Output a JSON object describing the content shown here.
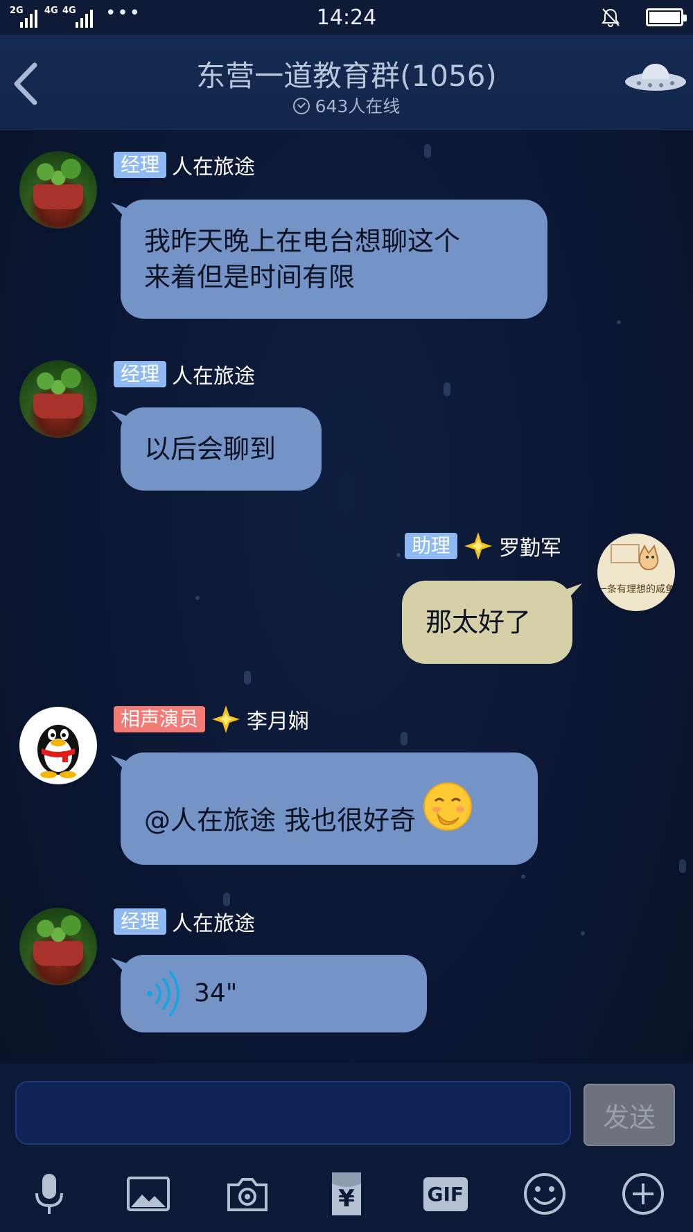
{
  "status_bar": {
    "net1_label": "2G",
    "net2_label": "4G",
    "net3_label": "4G",
    "more": "•••",
    "time": "14:24"
  },
  "header": {
    "title": "东营一道教育群(1056)",
    "online": "643人在线"
  },
  "messages": [
    {
      "badge": "经理",
      "name": "人在旅途",
      "text_line1": "我昨天晚上在电台想聊这个",
      "text_line2": "来着但是时间有限"
    },
    {
      "badge": "经理",
      "name": "人在旅途",
      "text": "以后会聊到"
    },
    {
      "badge": "助理",
      "name": "罗勤军",
      "text": "那太好了",
      "avatar_caption": "一条有理想的咸鱼"
    },
    {
      "badge": "相声演员",
      "name": "李月娴",
      "text": "@人在旅途 我也很好奇"
    },
    {
      "badge": "经理",
      "name": "人在旅途",
      "voice_duration": "34\""
    }
  ],
  "input": {
    "placeholder": "",
    "send_label": "发送"
  },
  "toolbar": {
    "gif_label": "GIF",
    "red_packet_label": "¥",
    "items": [
      "microphone-icon",
      "image-icon",
      "camera-icon",
      "red-packet-icon",
      "gif-icon",
      "emoji-icon",
      "plus-icon"
    ]
  },
  "colors": {
    "background": "#0b1630",
    "bubble_left": "#7494c8",
    "bubble_right": "#d5d0a7",
    "badge_blue": "#8fb9f3",
    "badge_red": "#f27b76",
    "send_button": "#6e727a"
  }
}
